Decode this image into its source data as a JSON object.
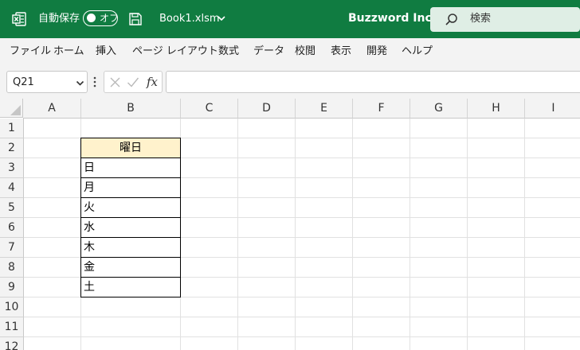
{
  "titlebar": {
    "autosave_label": "自動保存",
    "autosave_state": "オフ",
    "filename": "Book1.xlsm",
    "company": "Buzzword Inc.",
    "search_placeholder": "検索",
    "bg_color": "#107c41"
  },
  "menu": [
    "ファイル",
    "ホーム",
    "挿入",
    "ページ レイアウト",
    "数式",
    "データ",
    "校閲",
    "表示",
    "開発",
    "ヘルプ"
  ],
  "formula_bar": {
    "name_box": "Q21",
    "fx_label": "fx",
    "formula": ""
  },
  "sheet": {
    "columns": [
      "A",
      "B",
      "C",
      "D",
      "E",
      "F",
      "G",
      "H",
      "I"
    ],
    "rows": [
      "1",
      "2",
      "3",
      "4",
      "5",
      "6",
      "7",
      "8",
      "9",
      "10",
      "11",
      "12"
    ],
    "table": {
      "header": "曜日",
      "header_fill": "#fff2cc",
      "items": [
        "日",
        "月",
        "火",
        "水",
        "木",
        "金",
        "土"
      ]
    }
  }
}
